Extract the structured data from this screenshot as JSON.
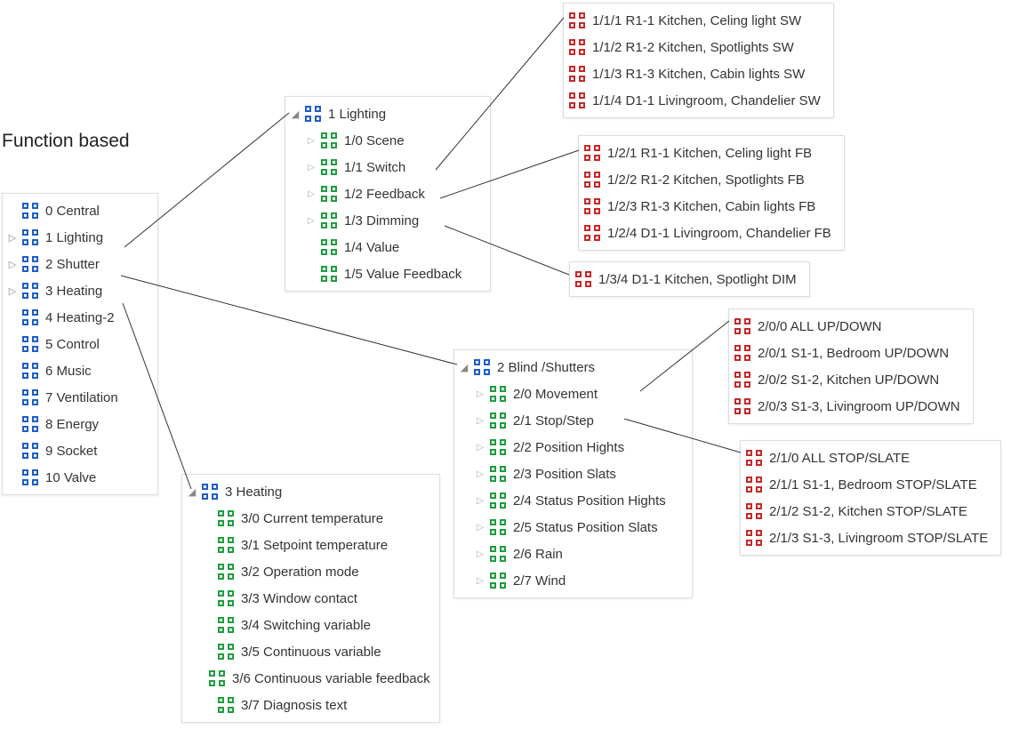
{
  "title": "Function based",
  "mainGroups": [
    {
      "addr": "0",
      "name": "Central",
      "expander": ""
    },
    {
      "addr": "1",
      "name": "Lighting",
      "expander": "▷"
    },
    {
      "addr": "2",
      "name": "Shutter",
      "expander": "▷"
    },
    {
      "addr": "3",
      "name": "Heating",
      "expander": "▷"
    },
    {
      "addr": "4",
      "name": "Heating-2",
      "expander": ""
    },
    {
      "addr": "5",
      "name": "Control",
      "expander": ""
    },
    {
      "addr": "6",
      "name": "Music",
      "expander": ""
    },
    {
      "addr": "7",
      "name": "Ventilation",
      "expander": ""
    },
    {
      "addr": "8",
      "name": "Energy",
      "expander": ""
    },
    {
      "addr": "9",
      "name": "Socket",
      "expander": ""
    },
    {
      "addr": "10",
      "name": "Valve",
      "expander": ""
    }
  ],
  "lighting": {
    "header": {
      "addr": "1",
      "name": "Lighting",
      "expander": "◢"
    },
    "items": [
      {
        "addr": "1/0",
        "name": "Scene",
        "expander": "▷"
      },
      {
        "addr": "1/1",
        "name": "Switch",
        "expander": "▷"
      },
      {
        "addr": "1/2",
        "name": "Feedback",
        "expander": "▷"
      },
      {
        "addr": "1/3",
        "name": "Dimming",
        "expander": "▷"
      },
      {
        "addr": "1/4",
        "name": "Value",
        "expander": ""
      },
      {
        "addr": "1/5",
        "name": "Value Feedback",
        "expander": ""
      }
    ]
  },
  "switchAddresses": [
    {
      "addr": "1/1/1",
      "name": "R1-1 Kitchen, Celing light SW"
    },
    {
      "addr": "1/1/2",
      "name": "R1-2 Kitchen, Spotlights SW"
    },
    {
      "addr": "1/1/3",
      "name": "R1-3 Kitchen, Cabin lights SW"
    },
    {
      "addr": "1/1/4",
      "name": "D1-1 Livingroom, Chandelier SW"
    }
  ],
  "feedbackAddresses": [
    {
      "addr": "1/2/1",
      "name": "R1-1 Kitchen, Celing light FB"
    },
    {
      "addr": "1/2/2",
      "name": "R1-2 Kitchen, Spotlights FB"
    },
    {
      "addr": "1/2/3",
      "name": "R1-3 Kitchen, Cabin lights FB"
    },
    {
      "addr": "1/2/4",
      "name": "D1-1 Livingroom, Chandelier  FB"
    }
  ],
  "dimmingAddresses": [
    {
      "addr": "1/3/4",
      "name": "D1-1 Kitchen, Spotlight DIM"
    }
  ],
  "shutters": {
    "header": {
      "addr": "2",
      "name": "Blind /Shutters",
      "expander": "◢"
    },
    "items": [
      {
        "addr": "2/0",
        "name": "Movement",
        "expander": "▷"
      },
      {
        "addr": "2/1",
        "name": "Stop/Step",
        "expander": "▷"
      },
      {
        "addr": "2/2",
        "name": "Position Hights",
        "expander": "▷"
      },
      {
        "addr": "2/3",
        "name": "Position Slats",
        "expander": "▷"
      },
      {
        "addr": "2/4",
        "name": "Status Position Hights",
        "expander": "▷"
      },
      {
        "addr": "2/5",
        "name": "Status Position Slats",
        "expander": "▷"
      },
      {
        "addr": "2/6",
        "name": "Rain",
        "expander": "▷"
      },
      {
        "addr": "2/7",
        "name": "Wind",
        "expander": "▷"
      }
    ]
  },
  "movementAddresses": [
    {
      "addr": "2/0/0",
      "name": "ALL UP/DOWN"
    },
    {
      "addr": "2/0/1",
      "name": "S1-1, Bedroom UP/DOWN"
    },
    {
      "addr": "2/0/2",
      "name": "S1-2, Kitchen UP/DOWN"
    },
    {
      "addr": "2/0/3",
      "name": "S1-3, Livingroom UP/DOWN"
    }
  ],
  "stopAddresses": [
    {
      "addr": "2/1/0",
      "name": "ALL STOP/SLATE"
    },
    {
      "addr": "2/1/1",
      "name": "S1-1, Bedroom STOP/SLATE"
    },
    {
      "addr": "2/1/2",
      "name": "S1-2, Kitchen STOP/SLATE"
    },
    {
      "addr": "2/1/3",
      "name": "S1-3, Livingroom STOP/SLATE"
    }
  ],
  "heating": {
    "header": {
      "addr": "3",
      "name": "Heating",
      "expander": "◢"
    },
    "items": [
      {
        "addr": "3/0",
        "name": "Current temperature"
      },
      {
        "addr": "3/1",
        "name": "Setpoint temperature"
      },
      {
        "addr": "3/2",
        "name": "Operation mode"
      },
      {
        "addr": "3/3",
        "name": "Window contact"
      },
      {
        "addr": "3/4",
        "name": "Switching variable"
      },
      {
        "addr": "3/5",
        "name": "Continuous variable"
      },
      {
        "addr": "3/6",
        "name": "Continuous variable feedback"
      },
      {
        "addr": "3/7",
        "name": "Diagnosis text"
      }
    ]
  }
}
